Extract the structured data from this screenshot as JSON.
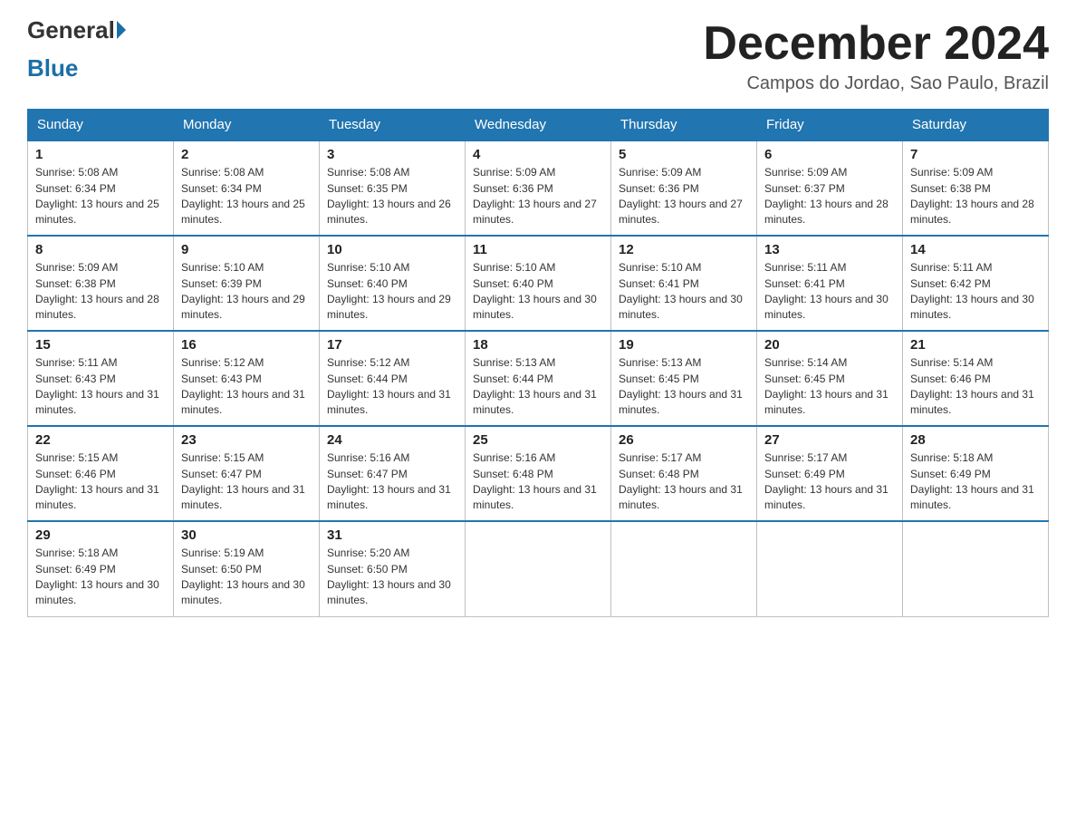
{
  "header": {
    "logo_general": "General",
    "logo_blue": "Blue",
    "title": "December 2024",
    "location": "Campos do Jordao, Sao Paulo, Brazil"
  },
  "weekdays": [
    "Sunday",
    "Monday",
    "Tuesday",
    "Wednesday",
    "Thursday",
    "Friday",
    "Saturday"
  ],
  "weeks": [
    [
      {
        "day": "1",
        "sunrise": "5:08 AM",
        "sunset": "6:34 PM",
        "daylight": "13 hours and 25 minutes."
      },
      {
        "day": "2",
        "sunrise": "5:08 AM",
        "sunset": "6:34 PM",
        "daylight": "13 hours and 25 minutes."
      },
      {
        "day": "3",
        "sunrise": "5:08 AM",
        "sunset": "6:35 PM",
        "daylight": "13 hours and 26 minutes."
      },
      {
        "day": "4",
        "sunrise": "5:09 AM",
        "sunset": "6:36 PM",
        "daylight": "13 hours and 27 minutes."
      },
      {
        "day": "5",
        "sunrise": "5:09 AM",
        "sunset": "6:36 PM",
        "daylight": "13 hours and 27 minutes."
      },
      {
        "day": "6",
        "sunrise": "5:09 AM",
        "sunset": "6:37 PM",
        "daylight": "13 hours and 28 minutes."
      },
      {
        "day": "7",
        "sunrise": "5:09 AM",
        "sunset": "6:38 PM",
        "daylight": "13 hours and 28 minutes."
      }
    ],
    [
      {
        "day": "8",
        "sunrise": "5:09 AM",
        "sunset": "6:38 PM",
        "daylight": "13 hours and 28 minutes."
      },
      {
        "day": "9",
        "sunrise": "5:10 AM",
        "sunset": "6:39 PM",
        "daylight": "13 hours and 29 minutes."
      },
      {
        "day": "10",
        "sunrise": "5:10 AM",
        "sunset": "6:40 PM",
        "daylight": "13 hours and 29 minutes."
      },
      {
        "day": "11",
        "sunrise": "5:10 AM",
        "sunset": "6:40 PM",
        "daylight": "13 hours and 30 minutes."
      },
      {
        "day": "12",
        "sunrise": "5:10 AM",
        "sunset": "6:41 PM",
        "daylight": "13 hours and 30 minutes."
      },
      {
        "day": "13",
        "sunrise": "5:11 AM",
        "sunset": "6:41 PM",
        "daylight": "13 hours and 30 minutes."
      },
      {
        "day": "14",
        "sunrise": "5:11 AM",
        "sunset": "6:42 PM",
        "daylight": "13 hours and 30 minutes."
      }
    ],
    [
      {
        "day": "15",
        "sunrise": "5:11 AM",
        "sunset": "6:43 PM",
        "daylight": "13 hours and 31 minutes."
      },
      {
        "day": "16",
        "sunrise": "5:12 AM",
        "sunset": "6:43 PM",
        "daylight": "13 hours and 31 minutes."
      },
      {
        "day": "17",
        "sunrise": "5:12 AM",
        "sunset": "6:44 PM",
        "daylight": "13 hours and 31 minutes."
      },
      {
        "day": "18",
        "sunrise": "5:13 AM",
        "sunset": "6:44 PM",
        "daylight": "13 hours and 31 minutes."
      },
      {
        "day": "19",
        "sunrise": "5:13 AM",
        "sunset": "6:45 PM",
        "daylight": "13 hours and 31 minutes."
      },
      {
        "day": "20",
        "sunrise": "5:14 AM",
        "sunset": "6:45 PM",
        "daylight": "13 hours and 31 minutes."
      },
      {
        "day": "21",
        "sunrise": "5:14 AM",
        "sunset": "6:46 PM",
        "daylight": "13 hours and 31 minutes."
      }
    ],
    [
      {
        "day": "22",
        "sunrise": "5:15 AM",
        "sunset": "6:46 PM",
        "daylight": "13 hours and 31 minutes."
      },
      {
        "day": "23",
        "sunrise": "5:15 AM",
        "sunset": "6:47 PM",
        "daylight": "13 hours and 31 minutes."
      },
      {
        "day": "24",
        "sunrise": "5:16 AM",
        "sunset": "6:47 PM",
        "daylight": "13 hours and 31 minutes."
      },
      {
        "day": "25",
        "sunrise": "5:16 AM",
        "sunset": "6:48 PM",
        "daylight": "13 hours and 31 minutes."
      },
      {
        "day": "26",
        "sunrise": "5:17 AM",
        "sunset": "6:48 PM",
        "daylight": "13 hours and 31 minutes."
      },
      {
        "day": "27",
        "sunrise": "5:17 AM",
        "sunset": "6:49 PM",
        "daylight": "13 hours and 31 minutes."
      },
      {
        "day": "28",
        "sunrise": "5:18 AM",
        "sunset": "6:49 PM",
        "daylight": "13 hours and 31 minutes."
      }
    ],
    [
      {
        "day": "29",
        "sunrise": "5:18 AM",
        "sunset": "6:49 PM",
        "daylight": "13 hours and 30 minutes."
      },
      {
        "day": "30",
        "sunrise": "5:19 AM",
        "sunset": "6:50 PM",
        "daylight": "13 hours and 30 minutes."
      },
      {
        "day": "31",
        "sunrise": "5:20 AM",
        "sunset": "6:50 PM",
        "daylight": "13 hours and 30 minutes."
      },
      null,
      null,
      null,
      null
    ]
  ]
}
